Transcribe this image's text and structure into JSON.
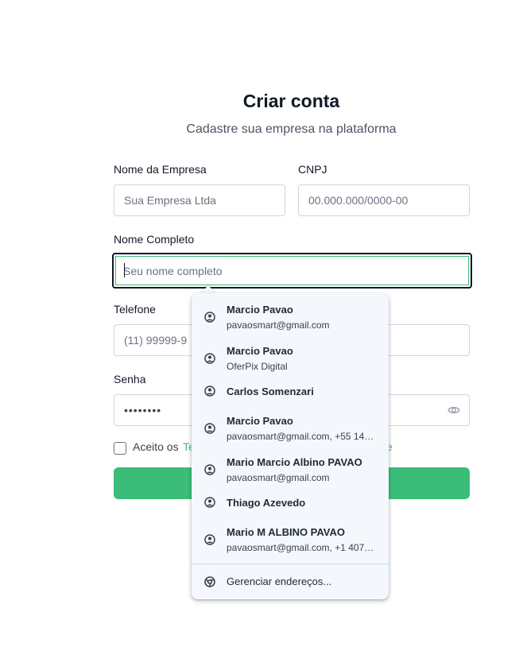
{
  "header": {
    "title": "Criar conta",
    "subtitle": "Cadastre sua empresa na plataforma"
  },
  "form": {
    "company_name": {
      "label": "Nome da Empresa",
      "placeholder": "Sua Empresa Ltda"
    },
    "cnpj": {
      "label": "CNPJ",
      "placeholder": "00.000.000/0000-00"
    },
    "full_name": {
      "label": "Nome Completo",
      "placeholder": "Seu nome completo"
    },
    "phone": {
      "label": "Telefone",
      "placeholder": "(11) 99999-9"
    },
    "password": {
      "label": "Senha",
      "value": "••••••••"
    },
    "terms": {
      "prefix": "Aceito os",
      "link_fragment": "Te",
      "link_suffix": "e"
    }
  },
  "autofill": {
    "items": [
      {
        "name": "Marcio Pavao",
        "detail": "pavaosmart@gmail.com"
      },
      {
        "name": "Marcio Pavao",
        "detail": "OferPix Digital"
      },
      {
        "name": "Carlos Somenzari",
        "detail": ""
      },
      {
        "name": "Marcio Pavao",
        "detail": "pavaosmart@gmail.com, +55 14…"
      },
      {
        "name": "Mario Marcio Albino PAVAO",
        "detail": "pavaosmart@gmail.com"
      },
      {
        "name": "Thiago Azevedo",
        "detail": ""
      },
      {
        "name": "Mario M ALBINO PAVAO",
        "detail": "pavaosmart@gmail.com, +1 407…"
      }
    ],
    "manage_label": "Gerenciar endereços..."
  },
  "colors": {
    "accent": "#3bbd79",
    "dropdown_bg": "#f4f8fc"
  }
}
